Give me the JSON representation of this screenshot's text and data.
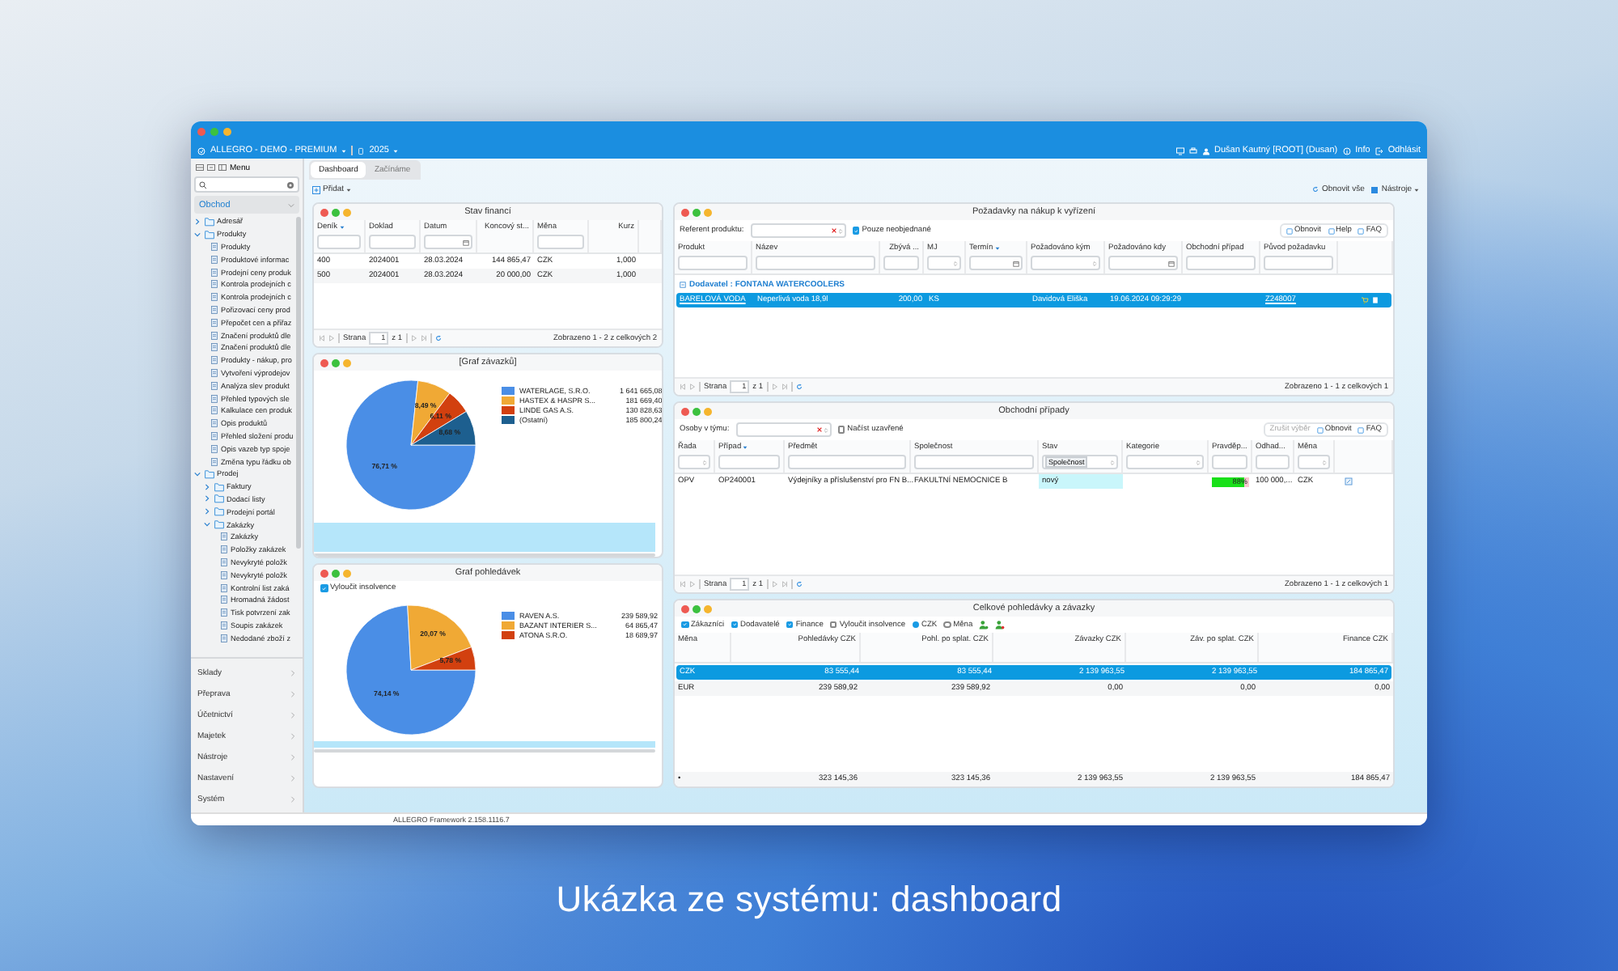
{
  "window": {
    "app_title": "ALLEGRO - DEMO - PREMIUM",
    "year": "2025",
    "user": "Dušan Kautný [ROOT] (Dusan)",
    "info": "Info",
    "logout": "Odhlásit"
  },
  "sidebar": {
    "title": "Menu",
    "section": {
      "label": "Obchod",
      "expanded": true
    },
    "tree": [
      {
        "label": "Adresář",
        "expanded": false
      },
      {
        "label": "Produkty",
        "expanded": true,
        "children": [
          {
            "label": "Produkty"
          },
          {
            "label": "Produktové informac"
          },
          {
            "label": "Prodejní ceny produk"
          },
          {
            "label": "Kontrola prodejních c"
          },
          {
            "label": "Kontrola prodejních c"
          },
          {
            "label": "Pořizovací ceny prod"
          },
          {
            "label": "Přepočet cen a přiřaz"
          },
          {
            "label": "Značení produktů dle"
          },
          {
            "label": "Značení produktů dle"
          },
          {
            "label": "Produkty - nákup, pro"
          },
          {
            "label": "Vytvoření výprodejov"
          },
          {
            "label": "Analýza slev produkt"
          },
          {
            "label": "Přehled typových sle"
          },
          {
            "label": "Kalkulace cen produk"
          },
          {
            "label": "Opis produktů"
          },
          {
            "label": "Přehled složení produ"
          },
          {
            "label": "Opis vazeb typ spoje"
          },
          {
            "label": "Změna typu řádku ob"
          }
        ]
      },
      {
        "label": "Prodej",
        "expanded": true,
        "children": [
          {
            "label": "Faktury",
            "expanded": false
          },
          {
            "label": "Dodací listy",
            "expanded": false
          },
          {
            "label": "Prodejní portál",
            "expanded": false
          },
          {
            "label": "Zakázky",
            "expanded": true,
            "children": [
              {
                "label": "Zakázky"
              },
              {
                "label": "Položky zakázek"
              },
              {
                "label": "Nevykryté položk"
              },
              {
                "label": "Nevykryté položk"
              },
              {
                "label": "Kontrolní list zaká"
              },
              {
                "label": "Hromadná žádost"
              },
              {
                "label": "Tisk potvrzení zak"
              },
              {
                "label": "Soupis zakázek"
              },
              {
                "label": "Nedodané zboží z"
              }
            ]
          }
        ]
      }
    ],
    "modules": [
      "Sklady",
      "Přeprava",
      "Účetnictví",
      "Majetek",
      "Nástroje",
      "Nastavení",
      "Systém"
    ]
  },
  "tabs": [
    {
      "label": "Dashboard",
      "selected": true
    },
    {
      "label": "Začínáme",
      "selected": false
    }
  ],
  "toolbar": {
    "add": "Přidat",
    "refresh_all": "Obnovit vše",
    "tools": "Nástroje"
  },
  "finance": {
    "title": "Stav financí",
    "columns": [
      {
        "label": "Deník",
        "sorted": true,
        "kind": "text"
      },
      {
        "label": "Doklad",
        "kind": "text"
      },
      {
        "label": "Datum",
        "kind": "date"
      },
      {
        "label": "Koncový st...",
        "numeric": true,
        "kind": "plain"
      },
      {
        "label": "Měna",
        "kind": "text"
      },
      {
        "label": "Kurz",
        "numeric": true,
        "kind": "plain"
      }
    ],
    "rows": [
      {
        "selected": false,
        "cells": [
          "400",
          "2024001",
          "28.03.2024",
          "144 865,47",
          "CZK",
          "1,000"
        ]
      },
      {
        "selected": false,
        "cells": [
          "500",
          "2024001",
          "28.03.2024",
          "20 000,00",
          "CZK",
          "1,000"
        ]
      }
    ],
    "pager": {
      "page_label": "Strana",
      "page": "1",
      "of": "z 1",
      "status": "Zobrazeno 1 - 2 z celkových 2"
    }
  },
  "liabilities_chart": {
    "title": "[Graf závazků]",
    "chart_data": {
      "type": "pie",
      "categories": [
        "WATERLAGE, S.R.O.",
        "HASTEX & HASPR S...",
        "LINDE GAS A.S.",
        "(Ostatní)"
      ],
      "values": [
        76.71,
        8.49,
        6.11,
        8.68
      ],
      "value_labels": [
        "76,71 %",
        "8,49 %",
        "6,11 %",
        "8,68 %"
      ],
      "legend": "right"
    },
    "legend_items": [
      {
        "amount": "1 641 665,08",
        "color": "#4a8ee6"
      },
      {
        "amount": "181 669,40",
        "color": "#f0a935"
      },
      {
        "amount": "130 828,63",
        "color": "#d2400f"
      },
      {
        "amount": "185 800,24",
        "color": "#1d5f8f"
      }
    ]
  },
  "receivables_chart": {
    "title": "Graf pohledávek",
    "exclude_insolvency": {
      "label": "Vyloučit insolvence",
      "checked": true
    },
    "chart_data": {
      "type": "pie",
      "categories": [
        "RAVEN A.S.",
        "BAZANT  INTERIER S...",
        "ATONA S.R.O."
      ],
      "values": [
        74.14,
        20.07,
        5.78
      ],
      "value_labels": [
        "74,14 %",
        "20,07 %",
        "5,78 %"
      ],
      "legend": "right"
    },
    "legend_items": [
      {
        "amount": "239 589,92",
        "color": "#4a8ee6"
      },
      {
        "amount": "64 865,47",
        "color": "#f0a935"
      },
      {
        "amount": "18 689,97",
        "color": "#d2400f"
      }
    ]
  },
  "requests": {
    "title": "Požadavky na nákup k vyřízení",
    "filter_label": "Referent produktu:",
    "only_unordered": {
      "label": "Pouze neobjednané",
      "checked": true
    },
    "actions": [
      "Obnovit",
      "Help",
      "FAQ"
    ],
    "columns": [
      {
        "label": "Produkt",
        "kind": "text"
      },
      {
        "label": "Název",
        "kind": "text"
      },
      {
        "label": "Zbývá ...",
        "kind": "text",
        "numeric": true
      },
      {
        "label": "MJ",
        "kind": "select"
      },
      {
        "label": "Termín",
        "sorted": true,
        "kind": "date"
      },
      {
        "label": "Požadováno kým",
        "kind": "select"
      },
      {
        "label": "Požadováno kdy",
        "kind": "date"
      },
      {
        "label": "Obchodní případ",
        "kind": "text"
      },
      {
        "label": "Původ požadavku",
        "kind": "text"
      }
    ],
    "group": "Dodavatel : FONTANA WATERCOOLERS",
    "rows": [
      {
        "selected": true,
        "cells": [
          {
            "kind": "link",
            "text": "BARELOVÁ VODA"
          },
          "Neperlivá voda 18,9l",
          "200,00",
          "KS",
          "",
          "Davidová Eliška",
          "19.06.2024 09:29:29",
          "",
          {
            "kind": "link",
            "text": "Z248007"
          }
        ]
      }
    ],
    "pager": {
      "page_label": "Strana",
      "page": "1",
      "of": "z 1",
      "status": "Zobrazeno 1 - 1 z celkových 1"
    }
  },
  "deals": {
    "title": "Obchodní případy",
    "filter_label": "Osoby v týmu:",
    "load_closed": {
      "label": "Načíst uzavřené",
      "checked": false
    },
    "actions": [
      {
        "label": "Zrušit výběr",
        "disabled": true
      },
      {
        "label": "Obnovit",
        "disabled": false
      },
      {
        "label": "FAQ",
        "disabled": false
      }
    ],
    "columns": [
      {
        "label": "Řada",
        "kind": "select"
      },
      {
        "label": "Případ",
        "sorted": true,
        "kind": "text"
      },
      {
        "label": "Předmět",
        "kind": "text"
      },
      {
        "label": "Společnost",
        "kind": "text"
      },
      {
        "label": "Stav",
        "kind": "select",
        "value": "Společnost"
      },
      {
        "label": "Kategorie",
        "kind": "select"
      },
      {
        "label": "Pravděp...",
        "kind": "text"
      },
      {
        "label": "Odhad...",
        "kind": "text"
      },
      {
        "label": "Měna",
        "kind": "select"
      }
    ],
    "rows": [
      {
        "selected": false,
        "cells": [
          "OPV",
          "OP240001",
          "Výdejníky a příslušenství pro FN B...",
          "FAKULTNÍ NEMOCNICE B",
          {
            "kind": "status",
            "text": "nový"
          },
          "",
          {
            "kind": "progress",
            "level": 0.88,
            "text": "88%"
          },
          "100 000,...",
          "CZK"
        ]
      }
    ],
    "pager": {
      "page_label": "Strana",
      "page": "1",
      "of": "z 1",
      "status": "Zobrazeno 1 - 1 z celkových 1"
    }
  },
  "totals": {
    "title": "Celkové pohledávky a závazky",
    "options": [
      {
        "kind": "checkbox",
        "label": "Zákazníci",
        "checked": true
      },
      {
        "kind": "checkbox",
        "label": "Dodavatelé",
        "checked": true
      },
      {
        "kind": "checkbox",
        "label": "Finance",
        "checked": true
      },
      {
        "kind": "checkbox",
        "label": "Vyloučit insolvence",
        "checked": false
      },
      {
        "kind": "radio",
        "label": "CZK",
        "checked": true
      },
      {
        "kind": "radio",
        "label": "Měna",
        "checked": false
      }
    ],
    "columns": [
      {
        "label": "Měna"
      },
      {
        "label": "Pohledávky CZK",
        "numeric": true
      },
      {
        "label": "Pohl. po splat. CZK",
        "numeric": true
      },
      {
        "label": "Závazky CZK",
        "numeric": true
      },
      {
        "label": "Záv. po splat. CZK",
        "numeric": true
      },
      {
        "label": "Finance CZK",
        "numeric": true
      }
    ],
    "rows": [
      {
        "selected": true,
        "cells": [
          "CZK",
          "83 555,44",
          "83 555,44",
          "2 139 963,55",
          "2 139 963,55",
          "184 865,47"
        ]
      },
      {
        "selected": false,
        "cells": [
          "EUR",
          "239 589,92",
          "239 589,92",
          "0,00",
          "0,00",
          "0,00"
        ]
      }
    ],
    "sum_row": [
      "•",
      "323 145,36",
      "323 145,36",
      "2 139 963,55",
      "2 139 963,55",
      "184 865,47"
    ]
  },
  "status_bar": "ALLEGRO Framework 2.158.1116.7",
  "caption": "Ukázka ze systému: dashboard"
}
